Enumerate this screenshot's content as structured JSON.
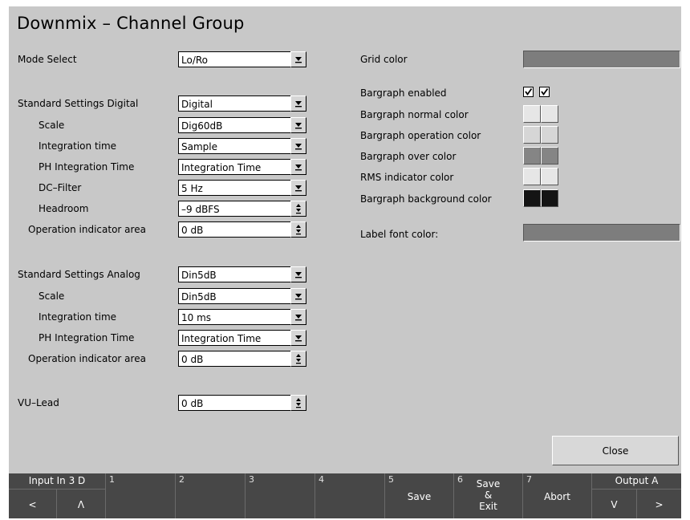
{
  "title": "Downmix – Channel Group",
  "mode": {
    "label": "Mode Select",
    "value": "Lo/Ro"
  },
  "digital": {
    "header_label": "Standard Settings Digital",
    "header_value": "Digital",
    "scale_label": "Scale",
    "scale_value": "Dig60dB",
    "integration_label": "Integration time",
    "integration_value": "Sample",
    "ph_label": "PH Integration Time",
    "ph_value": "Integration Time",
    "dc_label": "DC–Filter",
    "dc_value": "5 Hz",
    "headroom_label": "Headroom",
    "headroom_value": "–9 dBFS",
    "opind_label": "Operation indicator area",
    "opind_value": "0 dB"
  },
  "analog": {
    "header_label": "Standard Settings Analog",
    "header_value": "Din5dB",
    "scale_label": "Scale",
    "scale_value": "Din5dB",
    "integration_label": "Integration time",
    "integration_value": "10 ms",
    "ph_label": "PH Integration Time",
    "ph_value": "Integration Time",
    "opind_label": "Operation indicator area",
    "opind_value": "0 dB"
  },
  "vu": {
    "label": "VU–Lead",
    "value": "0 dB"
  },
  "right": {
    "grid_color_label": "Grid color",
    "grid_color": "#7d7d7d",
    "bargraph_enabled_label": "Bargraph enabled",
    "bargraph_enabled": [
      true,
      true
    ],
    "normal_label": "Bargraph normal color",
    "normal_colors": [
      "#e6e6e6",
      "#e6e6e6"
    ],
    "operation_label": "Bargraph operation color",
    "operation_colors": [
      "#d6d6d6",
      "#d6d6d6"
    ],
    "over_label": "Bargraph over color",
    "over_colors": [
      "#858585",
      "#858585"
    ],
    "rms_label": "RMS indicator color",
    "rms_colors": [
      "#e6e6e6",
      "#e6e6e6"
    ],
    "background_label": "Bargraph background color",
    "background_colors": [
      "#141414",
      "#141414"
    ],
    "label_font_label": "Label font color:",
    "label_font_color": "#7d7d7d"
  },
  "close_label": "Close",
  "softkeys": {
    "input_label": "Input In 3 D",
    "left_arrow": "<",
    "up_arrow": "Λ",
    "k1": "1",
    "k2": "2",
    "k3": "3",
    "k4": "4",
    "k5": "5",
    "save_label": "Save",
    "k6": "6",
    "save_exit_line1": "Save",
    "save_exit_line2": "&",
    "save_exit_line3": "Exit",
    "k7": "7",
    "abort_label": "Abort",
    "output_label": "Output A",
    "down_arrow": "V",
    "right_arrow": ">"
  },
  "icons": [
    "dropdown-arrow-icon",
    "spinner-arrows-icon",
    "checkmark-icon"
  ]
}
